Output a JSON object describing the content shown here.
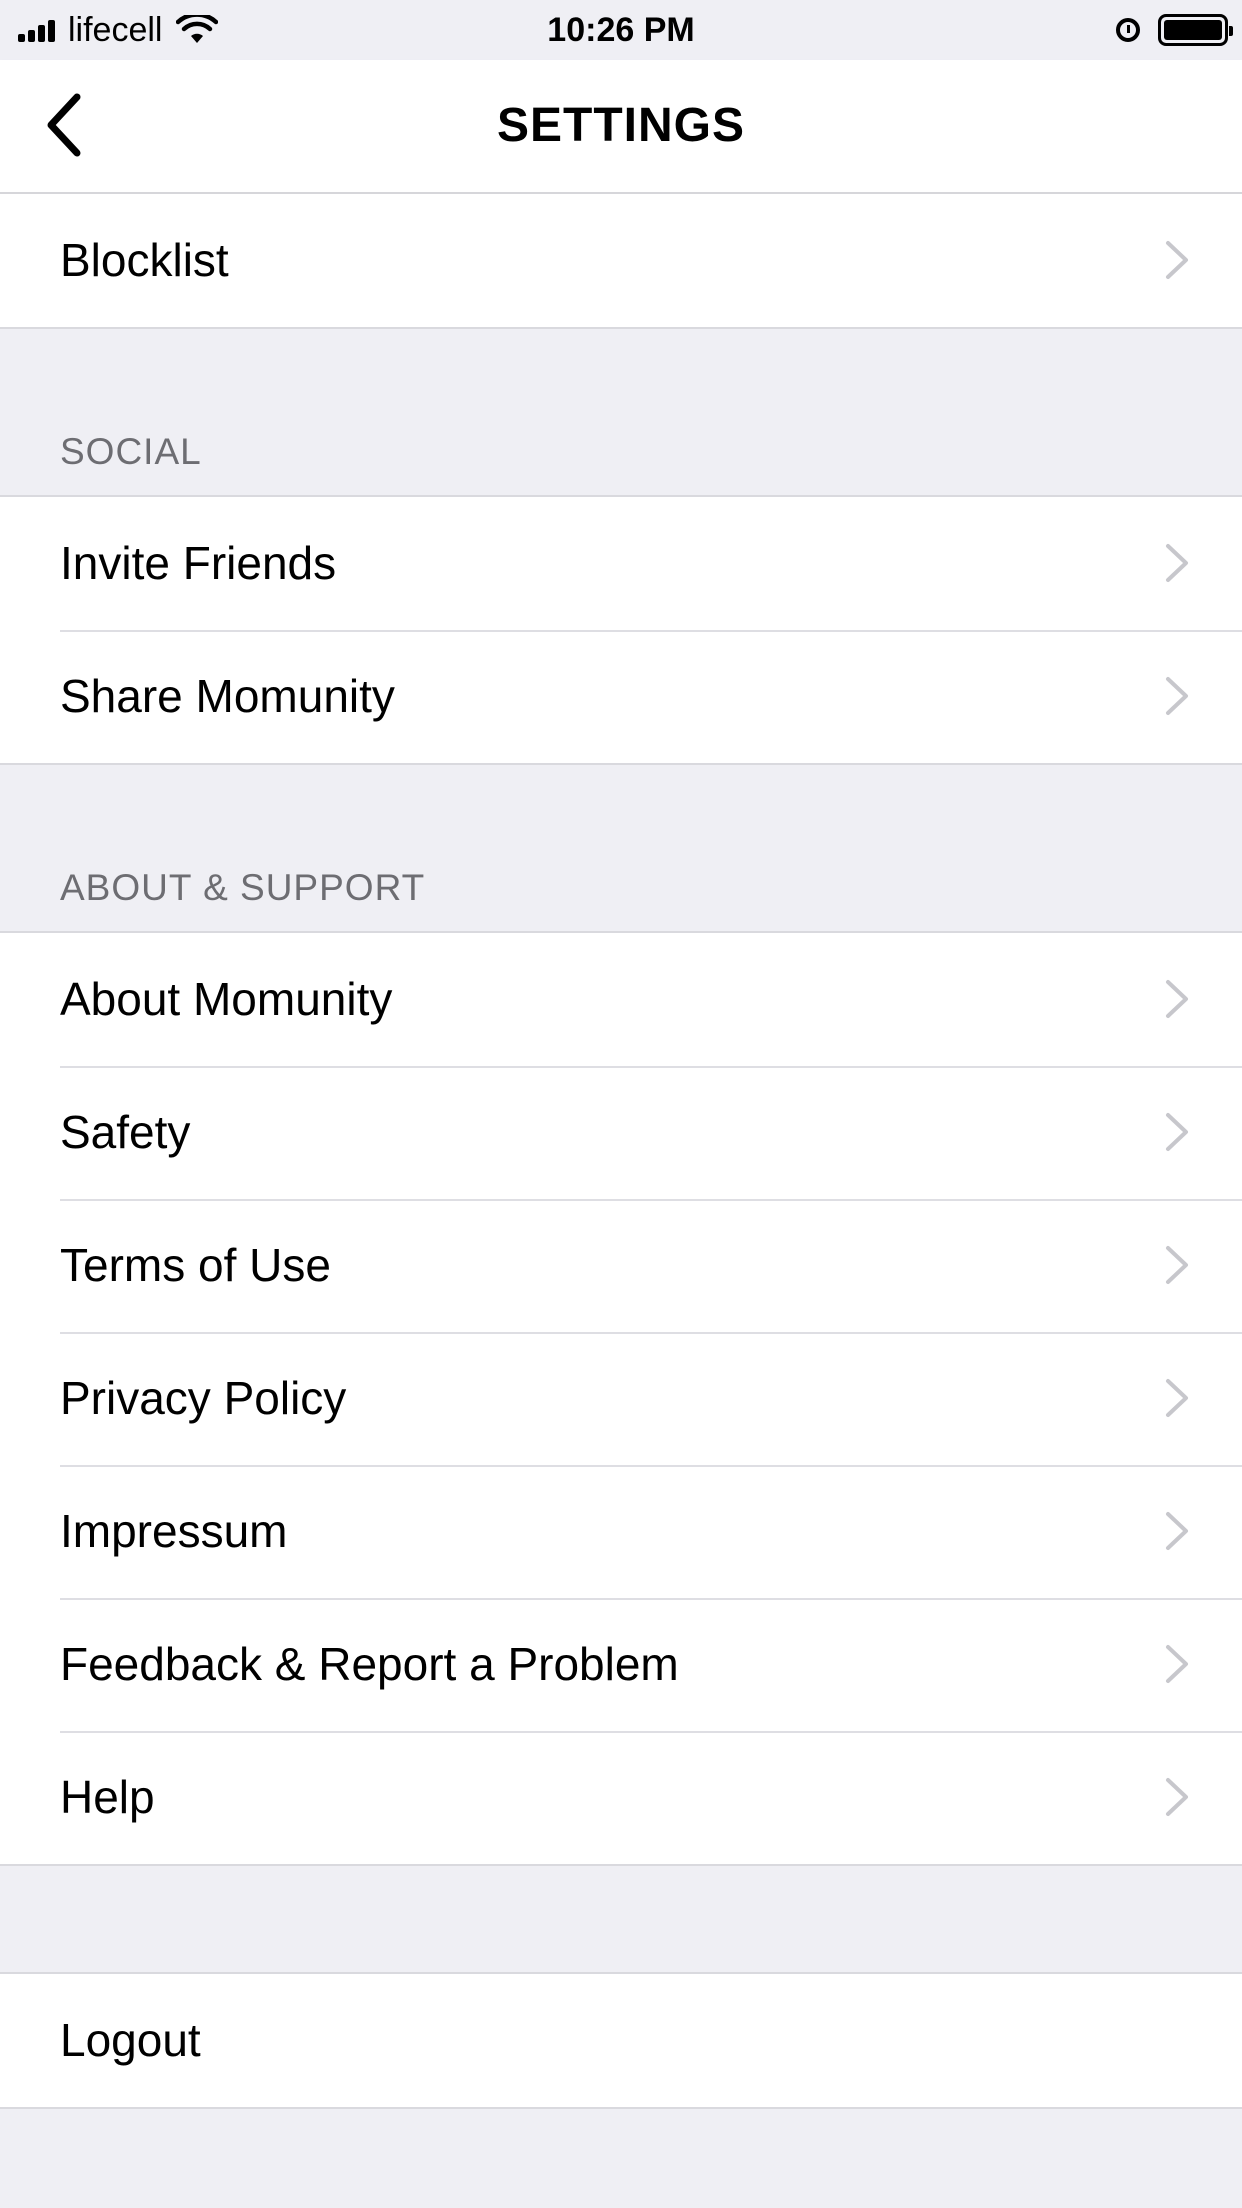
{
  "status_bar": {
    "carrier": "lifecell",
    "time": "10:26 PM",
    "icons": [
      "signal-icon",
      "wifi-icon",
      "alarm-icon",
      "battery-icon"
    ]
  },
  "nav": {
    "title": "SETTINGS",
    "back_icon": "chevron-left-icon"
  },
  "top_group": {
    "items": [
      {
        "label": "Blocklist"
      }
    ]
  },
  "social": {
    "header": "SOCIAL",
    "items": [
      {
        "label": "Invite Friends"
      },
      {
        "label": "Share Momunity"
      }
    ]
  },
  "about": {
    "header": "ABOUT & SUPPORT",
    "items": [
      {
        "label": "About Momunity"
      },
      {
        "label": "Safety"
      },
      {
        "label": "Terms of Use"
      },
      {
        "label": "Privacy Policy"
      },
      {
        "label": "Impressum"
      },
      {
        "label": "Feedback & Report a Problem"
      },
      {
        "label": "Help"
      }
    ]
  },
  "logout": {
    "label": "Logout"
  },
  "colors": {
    "background": "#efeff4",
    "row": "#ffffff",
    "section_text": "#6d6d72",
    "chevron": "#c7c7cc"
  }
}
